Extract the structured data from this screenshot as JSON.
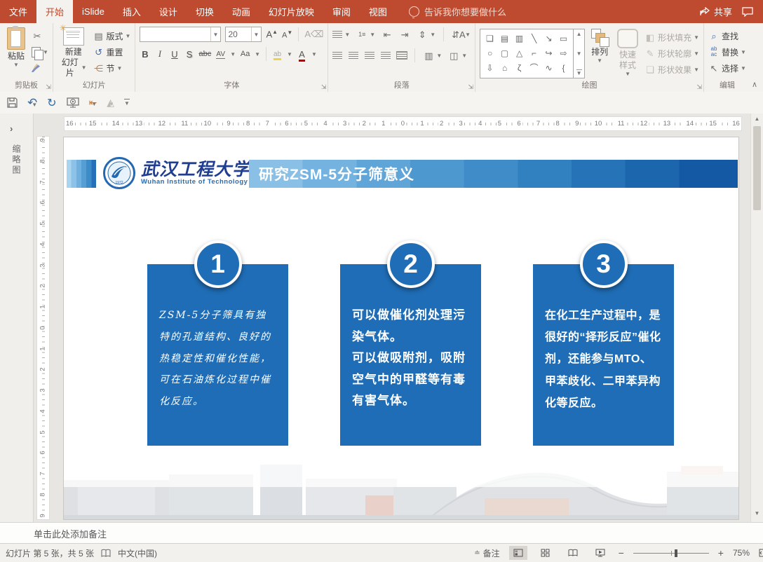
{
  "tabs": {
    "items": [
      "文件",
      "开始",
      "iSlide",
      "插入",
      "设计",
      "切换",
      "动画",
      "幻灯片放映",
      "审阅",
      "视图"
    ],
    "active": "开始",
    "tell_me": "告诉我你想要做什么",
    "share": "共享"
  },
  "ribbon": {
    "clipboard": {
      "group": "剪贴板",
      "paste": "粘贴",
      "cut_icon": "✂"
    },
    "slides": {
      "group": "幻灯片",
      "new_slide_line1": "新建",
      "new_slide_line2": "幻灯片",
      "layout": "版式",
      "reset": "重置",
      "section": "节"
    },
    "font": {
      "group": "字体",
      "font_name": "",
      "font_size": "20",
      "grow": "A",
      "shrink": "A",
      "bold": "B",
      "italic": "I",
      "underline": "U",
      "shadow": "S",
      "strike": "abc",
      "spacing": "AV",
      "case": "Aa",
      "highlight": "ab",
      "color": "A"
    },
    "paragraph": {
      "group": "段落"
    },
    "drawing": {
      "group": "绘图",
      "shapes": [
        "❏",
        "▤",
        "▥",
        "╲",
        "↘",
        "▭",
        "○",
        "▢",
        "△",
        "⌐",
        "↪",
        "⇨",
        "⇩",
        "⌂",
        "ζ",
        "⌒",
        "∿",
        "{"
      ],
      "arrange": "排列",
      "quick_styles": "快速样式",
      "shape_fill": "形状填充",
      "shape_outline": "形状轮廓",
      "shape_effects": "形状效果"
    },
    "editing": {
      "group": "编辑",
      "find": "查找",
      "replace": "替换",
      "select": "选择"
    }
  },
  "ruler": {
    "horizontal": [
      "16",
      "15",
      "14",
      "13",
      "12",
      "11",
      "10",
      "9",
      "8",
      "7",
      "6",
      "5",
      "4",
      "3",
      "2",
      "1",
      "0",
      "1",
      "2",
      "3",
      "4",
      "5",
      "6",
      "7",
      "8",
      "9",
      "10",
      "11",
      "12",
      "13",
      "14",
      "15",
      "16"
    ],
    "vertical": [
      "9",
      "8",
      "7",
      "6",
      "5",
      "4",
      "3",
      "2",
      "1",
      "0",
      "1",
      "2",
      "3",
      "4",
      "5",
      "6",
      "7",
      "8",
      "9"
    ]
  },
  "sidebar": {
    "thumbnails_label": "缩略图"
  },
  "slide": {
    "logo": {
      "name_cn": "武汉工程大学",
      "name_en": "Wuhan Institute of Technology"
    },
    "title": "研究ZSM-5分子筛意义",
    "cards": [
      {
        "number": "1",
        "p1": "ZSM-5分子筛具有独特的孔道结构、良好的热稳定性和催化性能，可在石油炼化过程中催化反应。",
        "p2": ""
      },
      {
        "number": "2",
        "p1": "可以做催化剂处理污染气体。",
        "p2": "可以做吸附剂，吸附空气中的甲醛等有毒有害气体。"
      },
      {
        "number": "3",
        "p1": "在化工生产过程中，是很好的“择形反应”催化剂，还能参与MTO、甲苯歧化、二甲苯异构化等反应。",
        "p2": ""
      }
    ]
  },
  "notes": {
    "placeholder": "单击此处添加备注"
  },
  "statusbar": {
    "slide_info": "幻灯片 第 5 张，共 5 张",
    "language": "中文(中国)",
    "notes_button": "备注",
    "zoom_level": "75%"
  },
  "colors": {
    "accent_red": "#BE4B30",
    "card_blue": "#1F6DB6",
    "title_gradient_start": "#8AC0E6",
    "title_gradient_end": "#1459A4"
  }
}
